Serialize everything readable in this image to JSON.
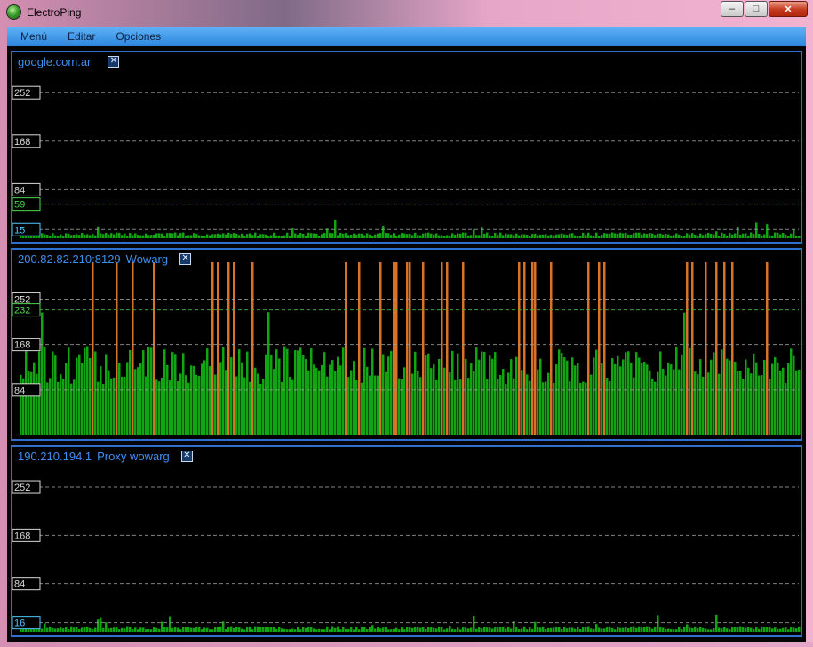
{
  "window": {
    "title": "ElectroPing",
    "icon": "electroping-globe-icon"
  },
  "menu": [
    "Menú",
    "Editar",
    "Opciones"
  ],
  "colors": {
    "ok": "#11a511",
    "over": "#d87228",
    "grid": "#2e8a2e",
    "accent": "#2f6fd0"
  },
  "panels": [
    {
      "host": "google.com.ar",
      "name": "",
      "axis": {
        "min": 0,
        "max": 300
      },
      "ticks": [
        252,
        168,
        84,
        59,
        15
      ],
      "current": 59,
      "minimum": 15,
      "limit": null,
      "latency": {
        "baseline": 4,
        "noise": 6,
        "spike_prob": 0.05,
        "spike_max": 22,
        "over_prob": 0,
        "seed": 7
      }
    },
    {
      "host": "200.82.82.210:8129",
      "name": "Wowarg",
      "axis": {
        "min": 0,
        "max": 320
      },
      "ticks": [
        252,
        232,
        168,
        84
      ],
      "current": 232,
      "minimum": null,
      "limit": 232,
      "latency": {
        "baseline": 95,
        "noise": 70,
        "spike_prob": 0.04,
        "spike_max": 160,
        "over_prob": 0.12,
        "seed": 13
      }
    },
    {
      "host": "190.210.194.1",
      "name": "Proxy wowarg",
      "axis": {
        "min": 0,
        "max": 300
      },
      "ticks": [
        252,
        168,
        84,
        16
      ],
      "current": null,
      "minimum": 16,
      "limit": null,
      "latency": {
        "baseline": 4,
        "noise": 6,
        "spike_prob": 0.05,
        "spike_max": 22,
        "over_prob": 0,
        "seed": 23
      }
    }
  ]
}
